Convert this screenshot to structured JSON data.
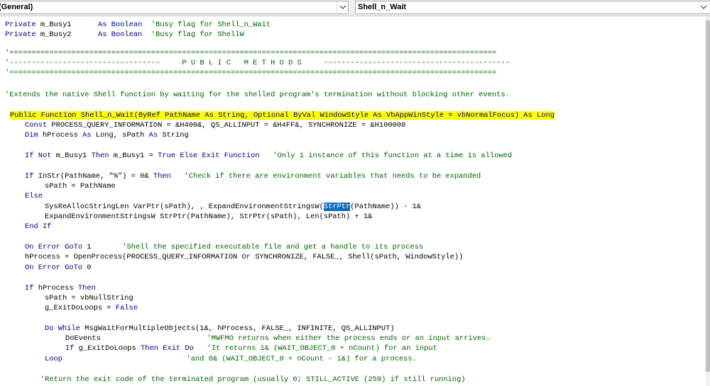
{
  "toolbar": {
    "object_combo": "(General)",
    "procedure_combo": "Shell_n_Wait"
  },
  "code": {
    "l1": [
      "Private",
      " m_Busy1      ",
      "As Boolean",
      "  'Busy flag for Shell_n_Wait"
    ],
    "l2": [
      "Private",
      " m_Busy2      ",
      "As Boolean",
      "  'Busy flag for ShellW"
    ],
    "sep1": "'==============================================================================================================",
    "sep_mid": "'----------------------------------     P U B L I C   M E T H O D S     ------------------------------------------",
    "sep2": "'==============================================================================================================",
    "c_extends": "'Extends the native Shell function by waiting for the shelled program's termination without blocking other events.",
    "fn_decl": "Public Function Shell_n_Wait(ByRef PathName As String, Optional ByVal WindowStyle As VbAppWinStyle = vbNormalFocus) As Long",
    "l_const": [
      "Const",
      " PROCESS_QUERY_INFORMATION = &H400&, QS_ALLINPUT = &H4FF&, SYNCHRONIZE = &H100000"
    ],
    "l_dim": [
      "Dim",
      " hProcess ",
      "As",
      " Long, sPath ",
      "As",
      " String"
    ],
    "l_ifnot": [
      "If",
      " ",
      "Not",
      " m_Busy1 ",
      "Then",
      " m_Busy1 = ",
      "True",
      " ",
      "Else",
      " ",
      "Exit",
      " ",
      "Function",
      "   ",
      "'Only 1 instance of this function at a time is allowed"
    ],
    "l_ifinstr": [
      "If",
      " InStr(PathName, \"%\") = 0& ",
      "Then",
      "   ",
      "'Check if there are environment variables that needs to be expanded"
    ],
    "l_spath1": "sPath = PathName",
    "l_else": "Else",
    "l_sysre": [
      "SysReAllocStringLen VarPtr(sPath), , ExpandEnvironmentStringsW(",
      "StrPtr",
      "(PathName)) - 1&"
    ],
    "l_expand": "ExpandEnvironmentStringsW StrPtr(PathName), StrPtr(sPath), Len(sPath) + 1&",
    "l_endif": "End If",
    "l_onerr1": [
      "On Error GoTo",
      " 1       ",
      "'Shell the specified executable file and get a handle to its process"
    ],
    "l_openproc": [
      "hProcess = OpenProcess(PROCESS_QUERY_INFORMATION ",
      "Or",
      " SYNCHRONIZE, FALSE_, Shell(sPath, WindowStyle))"
    ],
    "l_onerr0": [
      "On Error GoTo",
      " 0"
    ],
    "l_ifh": [
      "If",
      " hProcess ",
      "Then"
    ],
    "l_spath2": "sPath = vbNullString",
    "l_gexit": [
      "g_ExitDoLoops = ",
      "False"
    ],
    "l_dowhile": [
      "Do While",
      " MsgWaitForMultipleObjects(1&, hProcess, FALSE_, INFINITE, QS_ALLINPUT)"
    ],
    "l_doevents": [
      "DoEvents                        ",
      "'MWFMO returns when either the process ends or an input arrives."
    ],
    "l_ifg": [
      "If",
      " g_ExitDoLoops ",
      "Then",
      " ",
      "Exit",
      " ",
      "Do",
      "   ",
      "'It returns 1& (WAIT_OBJECT_0 + nCount) for an input"
    ],
    "l_loop": [
      "Loop",
      "                            ",
      "'and 0& (WAIT_OBJECT_0 + nCount - 1&) for a process."
    ],
    "l_return": "'Return the exit code of the terminated program (usually 0; STILL_ACTIVE (259) if still running)"
  }
}
